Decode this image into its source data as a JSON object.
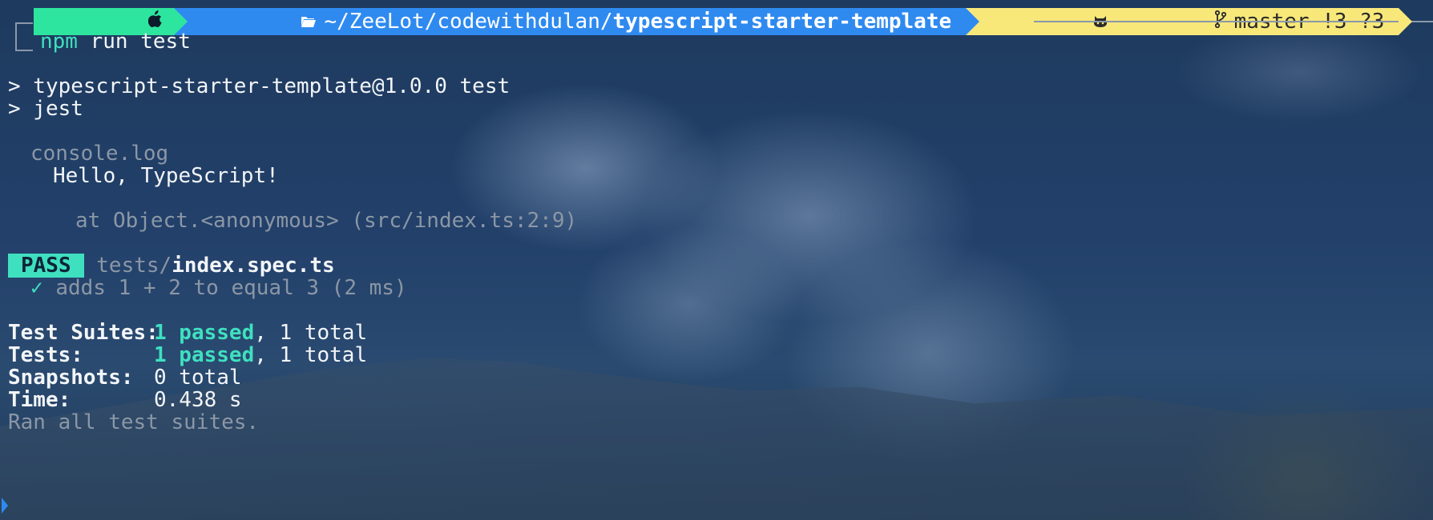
{
  "prompt": {
    "apple_icon": "apple-icon",
    "folder_icon": "folder-icon",
    "path_prefix": "~/ZeeLot/codewithdulan/",
    "path_bold": "typescript-starter-template",
    "git_icon": "github-icon",
    "branch_icon": "git-branch-icon",
    "branch": "master",
    "status": "!3 ?3",
    "colors": {
      "apple_segment": "#2ee59f",
      "path_segment": "#2f8af0",
      "git_segment": "#f8e87a"
    }
  },
  "command": {
    "keyword": "npm",
    "rest": " run test"
  },
  "output": {
    "script_line1": "> typescript-starter-template@1.0.0 test",
    "script_line2": "> jest",
    "console_label": "console.log",
    "console_message": "Hello, TypeScript!",
    "stack_trace": "at Object.<anonymous> (src/index.ts:2:9)",
    "pass_badge": "PASS",
    "test_dir": "tests/",
    "test_file": "index.spec.ts",
    "check_mark": "✓",
    "test_case": "adds 1 + 2 to equal 3 (2 ms)",
    "summary": {
      "suites_label": "Test Suites:",
      "suites_passed": "1 passed",
      "suites_total": ", 1 total",
      "tests_label": "Tests:",
      "tests_passed": "1 passed",
      "tests_total": ", 1 total",
      "snapshots_label": "Snapshots:",
      "snapshots_value": "0 total",
      "time_label": "Time:",
      "time_value": "0.438 s"
    },
    "ran_all": "Ran all test suites."
  }
}
